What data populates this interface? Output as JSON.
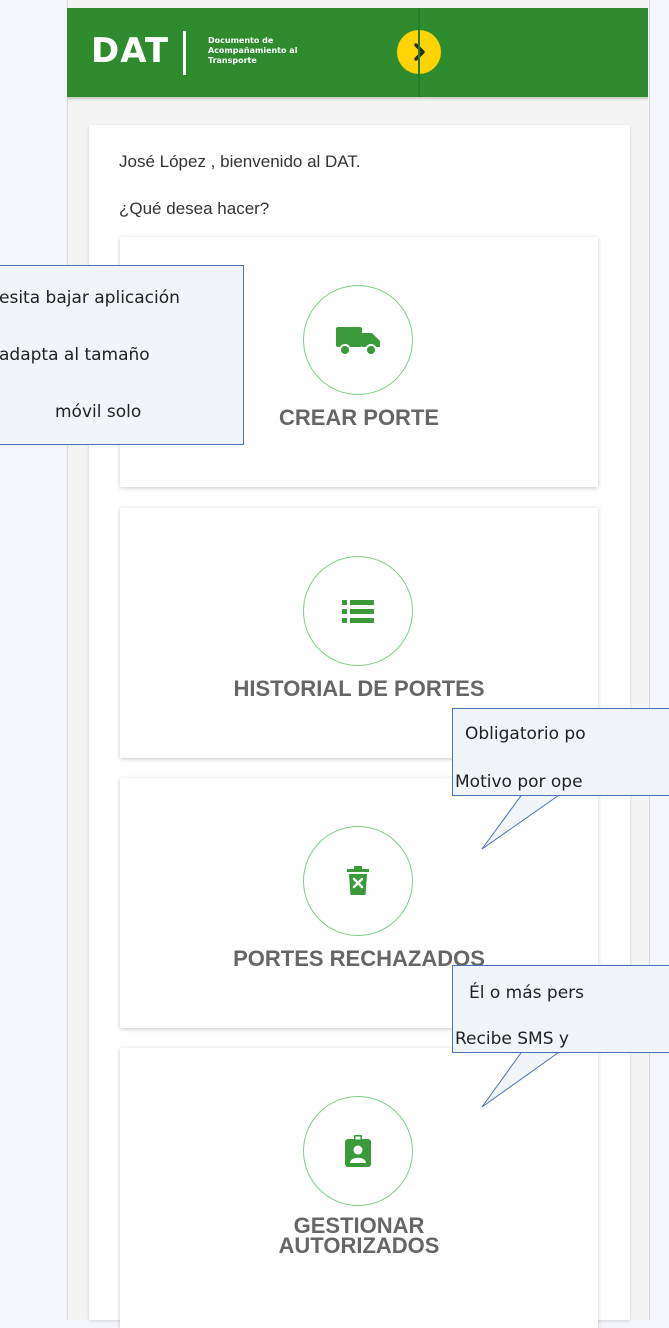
{
  "header": {
    "logo": "DAT",
    "logo_subtitle": "Documento de Acompañamiento al Transporte"
  },
  "main": {
    "welcome": "José López , bienvenido al DAT.",
    "question": "¿Qué desea hacer?",
    "actions": [
      {
        "label": "CREAR PORTE",
        "icon": "truck-icon"
      },
      {
        "label": "HISTORIAL DE PORTES",
        "icon": "list-icon"
      },
      {
        "label": "PORTES RECHAZADOS",
        "icon": "trash-icon"
      },
      {
        "label": "GESTIONAR AUTORIZADOS",
        "label_line1": "GESTIONAR",
        "label_line2": "AUTORIZADOS",
        "icon": "badge-icon"
      }
    ]
  },
  "annotations": {
    "note1": [
      "esita bajar aplicación",
      "adapta al tamaño",
      "móvil solo"
    ],
    "note2": [
      "Obligatorio po",
      "Motivo por ope"
    ],
    "note3": [
      "Él o más pers",
      "Recibe SMS y "
    ]
  },
  "colors": {
    "header_green": "#2e8b2e",
    "accent_yellow": "#ffd400",
    "icon_green": "#3a9a3a",
    "circle_border": "#7fcf7f"
  }
}
